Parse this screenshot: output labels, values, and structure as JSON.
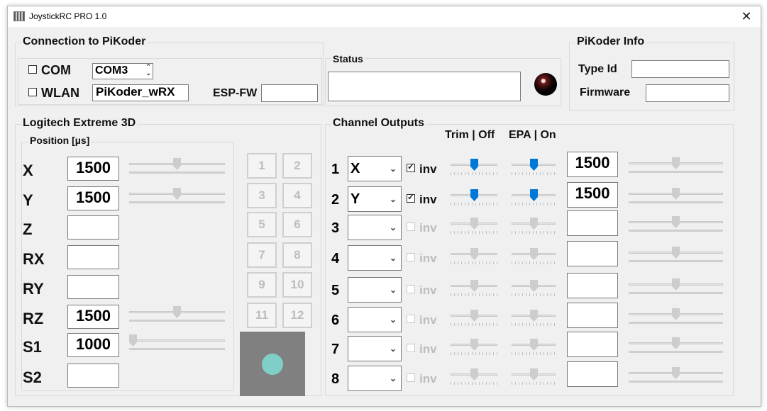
{
  "window": {
    "title": "JoystickRC PRO 1.0",
    "close_glyph": "✕"
  },
  "connection": {
    "title": "Connection to PiKoder",
    "com_label": "COM",
    "com_value": "COM3",
    "wlan_label": "WLAN",
    "wlan_value": "PiKoder_wRX",
    "espfw_label": "ESP-FW",
    "espfw_value": ""
  },
  "status": {
    "title": "Status",
    "value": ""
  },
  "info": {
    "title": "PiKoder Info",
    "typeid_label": "Type Id",
    "typeid_value": "",
    "firmware_label": "Firmware",
    "firmware_value": ""
  },
  "joystick": {
    "title": "Logitech Extreme 3D",
    "position_title": "Position [µs]",
    "axes": [
      {
        "name": "X",
        "value": "1500",
        "slider": 0.5
      },
      {
        "name": "Y",
        "value": "1500",
        "slider": 0.5
      },
      {
        "name": "Z",
        "value": ""
      },
      {
        "name": "RX",
        "value": ""
      },
      {
        "name": "RY",
        "value": ""
      },
      {
        "name": "RZ",
        "value": "1500",
        "slider": 0.5
      },
      {
        "name": "S1",
        "value": "1000",
        "slider": 0.0
      },
      {
        "name": "S2",
        "value": ""
      }
    ],
    "buttons": [
      "1",
      "2",
      "3",
      "4",
      "5",
      "6",
      "7",
      "8",
      "9",
      "10",
      "11",
      "12"
    ],
    "hat_color": "#808080",
    "hat_dot_color": "#7fcfc8"
  },
  "channels": {
    "title": "Channel Outputs",
    "trim_header": "Trim | Off",
    "epa_header": "EPA | On",
    "inv_label": "inv",
    "rows": [
      {
        "num": "1",
        "axis": "X",
        "inv": true,
        "enabled": true,
        "value": "1500"
      },
      {
        "num": "2",
        "axis": "Y",
        "inv": true,
        "enabled": true,
        "value": "1500"
      },
      {
        "num": "3",
        "axis": "",
        "inv": false,
        "enabled": false,
        "value": ""
      },
      {
        "num": "4",
        "axis": "",
        "inv": false,
        "enabled": false,
        "value": ""
      },
      {
        "num": "5",
        "axis": "",
        "inv": false,
        "enabled": false,
        "value": ""
      },
      {
        "num": "6",
        "axis": "",
        "inv": false,
        "enabled": false,
        "value": ""
      },
      {
        "num": "7",
        "axis": "",
        "inv": false,
        "enabled": false,
        "value": ""
      },
      {
        "num": "8",
        "axis": "",
        "inv": false,
        "enabled": false,
        "value": ""
      }
    ]
  },
  "colors": {
    "accent": "#0078d7",
    "background": "#f0f0f0"
  }
}
